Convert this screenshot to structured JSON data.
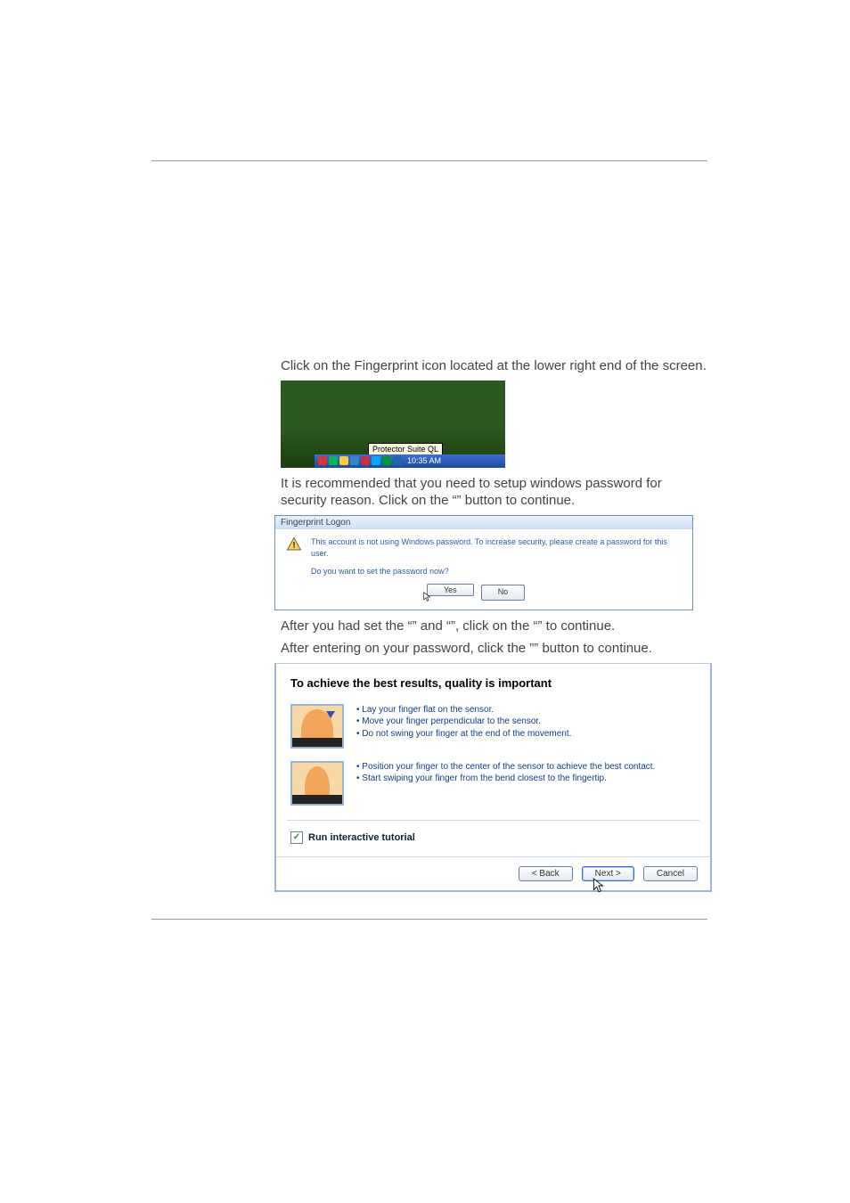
{
  "step1_text": "Click on the Fingerprint icon located at the lower right end of the screen.",
  "tray": {
    "tooltip": "Protector Suite QL",
    "time": "10:35 AM"
  },
  "step2_text_a": "It is recommended that you need to setup windows password for security reason. Click on the “",
  "step2_text_b": "” button to continue.",
  "dialog": {
    "title": "Fingerprint Logon",
    "line1": "This account is not using Windows password. To increase security, please create a password for this user.",
    "line2": "Do you want to set the password now?",
    "yes": "Yes",
    "no": "No"
  },
  "step3_a": "After you had set the “",
  "step3_b": "” and “",
  "step3_c": "”, click on the “",
  "step3_d": "” to continue.",
  "step4_a": "After entering on your password, click the ”",
  "step4_b": "” button to continue.",
  "wizard": {
    "heading": "To achieve the best results, quality is important",
    "tips_a": [
      "Lay your finger flat on the sensor.",
      "Move your finger perpendicular to the sensor.",
      "Do not swing your finger at the end of the movement."
    ],
    "tips_b": [
      "Position your finger to the center of the sensor to achieve the best contact.",
      "Start swiping your finger from the bend closest to the fingertip."
    ],
    "checkbox": "Run interactive tutorial",
    "back": "< Back",
    "next": "Next >",
    "cancel": "Cancel"
  }
}
